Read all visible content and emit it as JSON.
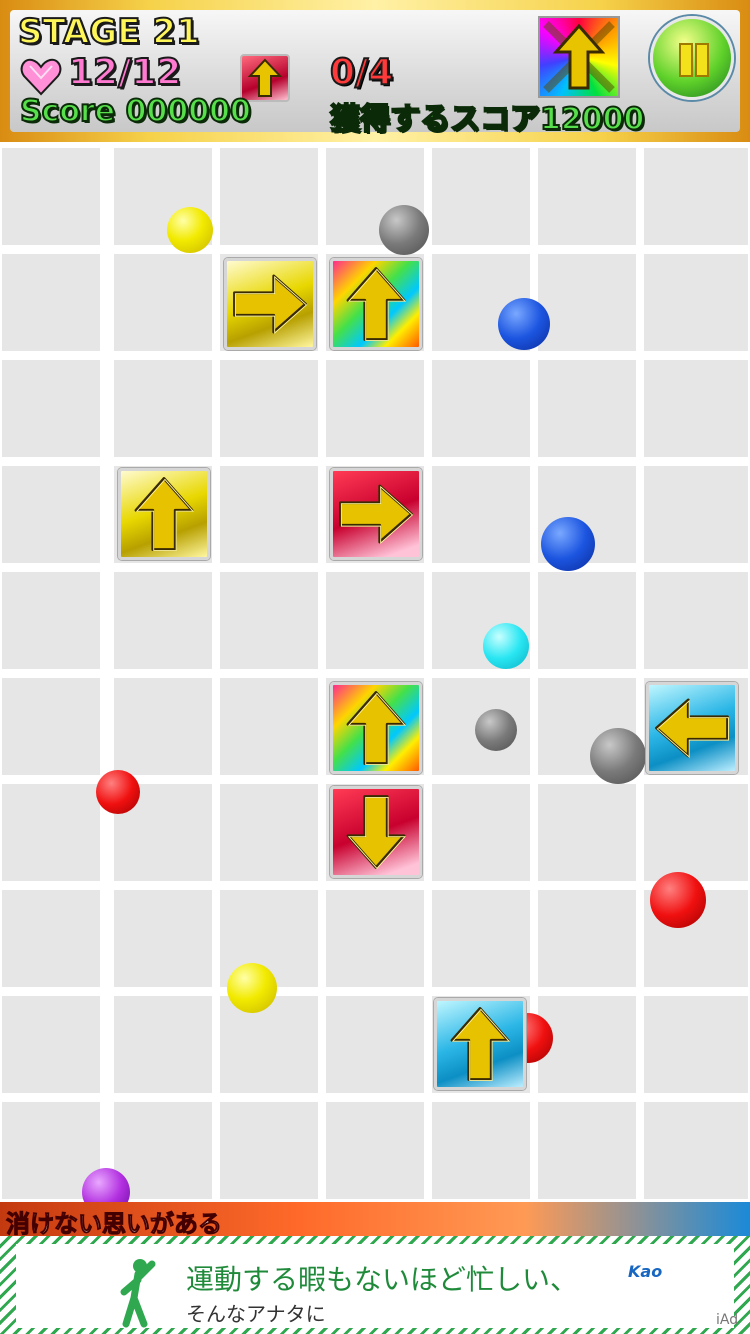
{
  "hud": {
    "stage": "STAGE 21",
    "lives": "12/12",
    "count": "0/4",
    "score": "Score 000000",
    "target": "獲得するスコア12000"
  },
  "board": {
    "tiles": [
      {
        "kind": "yellow",
        "arrow": "right",
        "name": "tile-yellow-right"
      },
      {
        "kind": "rainbow",
        "arrow": "up",
        "name": "tile-rainbow-up-top"
      },
      {
        "kind": "yellow",
        "arrow": "up",
        "name": "tile-yellow-up"
      },
      {
        "kind": "red",
        "arrow": "right",
        "name": "tile-red-right"
      },
      {
        "kind": "rainbow",
        "arrow": "up",
        "name": "tile-rainbow-up-middle"
      },
      {
        "kind": "cyan",
        "arrow": "left",
        "name": "tile-cyan-left"
      },
      {
        "kind": "red",
        "arrow": "down",
        "name": "tile-red-down"
      },
      {
        "kind": "cyan",
        "arrow": "up",
        "name": "tile-cyan-up"
      }
    ],
    "balls": [
      {
        "color": "yellow"
      },
      {
        "color": "gray"
      },
      {
        "color": "blue"
      },
      {
        "color": "blue"
      },
      {
        "color": "cyan"
      },
      {
        "color": "gray"
      },
      {
        "color": "gray"
      },
      {
        "color": "red"
      },
      {
        "color": "red"
      },
      {
        "color": "yellow"
      },
      {
        "color": "red"
      },
      {
        "color": "purple"
      }
    ]
  },
  "ad": {
    "strip_text": "消けない思いがある",
    "headline": "運動する暇もないほど忙しい、",
    "subline": "そんなアナタに",
    "brand": "Kao",
    "tag": "iAd"
  },
  "colors": {
    "gold": "#fff65a",
    "score_green": "#58e04c",
    "ad_green": "#1f8a3a"
  }
}
